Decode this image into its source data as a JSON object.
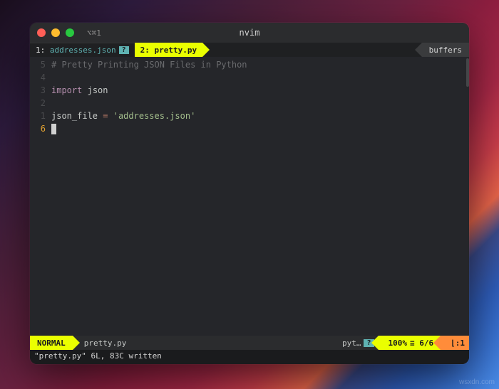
{
  "titlebar": {
    "tab_indicator": "⌥⌘1",
    "title": "nvim"
  },
  "buffers": {
    "tab1": {
      "num": "1:",
      "name": "addresses.json",
      "flag": "?"
    },
    "tab2": {
      "num": "2:",
      "name": "pretty.py"
    },
    "label": "buffers"
  },
  "gutter": {
    "l1": "5",
    "l2": "4",
    "l3": "3",
    "l4": "2",
    "l5": "1",
    "l6": "6"
  },
  "code": {
    "comment": "# Pretty Printing JSON Files in Python",
    "import_kw": "import",
    "import_mod": "json",
    "var": "json_file",
    "eq": "=",
    "str": "'addresses.json'"
  },
  "status": {
    "mode": "NORMAL",
    "filename": "pretty.py",
    "filetype": "pyt…",
    "ft_flag": "?",
    "percent": "100%",
    "lines": "≡ 6/6",
    "pos": "⌊:1"
  },
  "cmdline": "\"pretty.py\" 6L, 83C written",
  "watermark": "wsxdn.com"
}
